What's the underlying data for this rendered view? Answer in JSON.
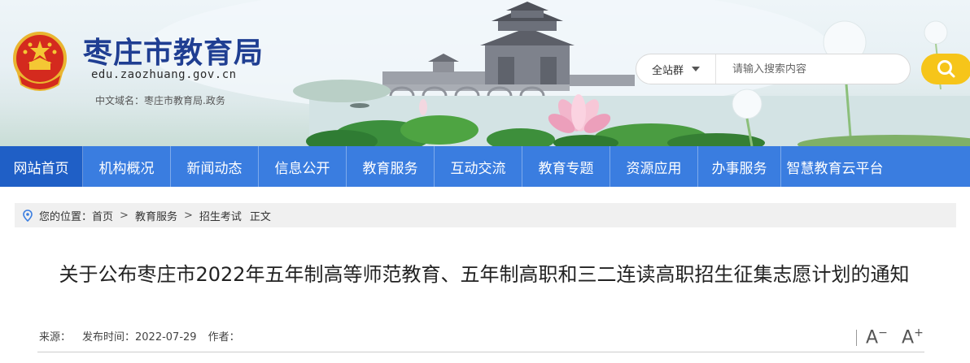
{
  "site": {
    "title": "枣庄市教育局",
    "domain": "edu.zaozhuang.gov.cn",
    "cn_domain": "中文域名：枣庄市教育局.政务"
  },
  "search": {
    "scope": "全站群",
    "placeholder": "请输入搜索内容"
  },
  "nav": {
    "items": [
      {
        "label": "网站首页",
        "active": true
      },
      {
        "label": "机构概况"
      },
      {
        "label": "新闻动态"
      },
      {
        "label": "信息公开"
      },
      {
        "label": "教育服务"
      },
      {
        "label": "互动交流"
      },
      {
        "label": "教育专题"
      },
      {
        "label": "资源应用"
      },
      {
        "label": "办事服务"
      },
      {
        "label": "智慧教育云平台"
      }
    ]
  },
  "breadcrumb": {
    "prefix": "您的位置：",
    "items": [
      "首页",
      "教育服务",
      "招生考试"
    ],
    "current": "正文",
    "separator": ">"
  },
  "article": {
    "title": "关于公布枣庄市2022年五年制高等师范教育、五年制高职和三二连读高职招生征集志愿计划的通知",
    "source_label": "来源：",
    "date_label": "发布时间：2022-07-29",
    "author_label": "作者："
  },
  "font_controls": {
    "decrease": "A",
    "decrease_sign": "−",
    "increase": "A",
    "increase_sign": "+"
  },
  "colors": {
    "nav_bg": "#3a7de0",
    "nav_active": "#1f5fc6",
    "title_blue": "#1f3e92",
    "search_button": "#f6c51a"
  },
  "icons": [
    "national-emblem-icon",
    "search-icon",
    "location-pin-icon",
    "chevron-down-icon"
  ]
}
